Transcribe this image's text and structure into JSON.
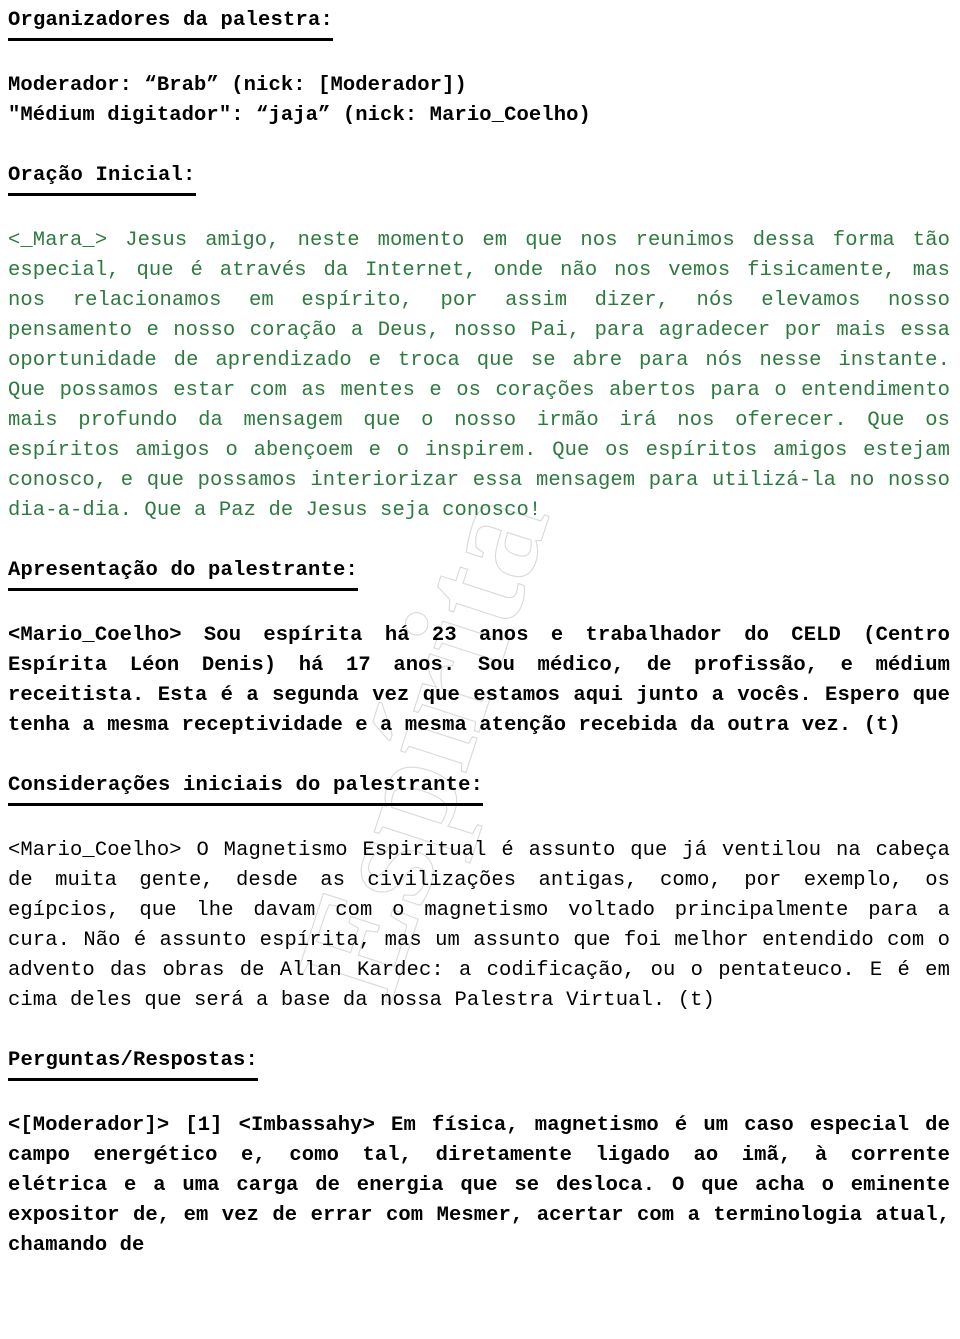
{
  "document": {
    "page_background": "#ffffff",
    "text_color": "#000000",
    "prayer_color": "#2d7a3e",
    "watermark_color": "#b9b9c4",
    "watermark_text": "Espírita"
  },
  "sections": {
    "organizers": {
      "heading": "Organizadores da palestra:",
      "lines": [
        "Moderador: “Brab” (nick: [Moderador])",
        "\"Médium digitador\": “jaja” (nick: Mario_Coelho)"
      ]
    },
    "opening_prayer": {
      "heading": "Oração Inicial:",
      "body": "<_Mara_> Jesus amigo, neste momento em que nos reunimos dessa forma tão especial, que é através da Internet, onde não nos vemos fisicamente, mas nos relacionamos em espírito, por assim dizer, nós elevamos nosso pensamento e nosso coração a Deus, nosso Pai, para agradecer por mais essa oportunidade de aprendizado e troca que se abre para nós nesse instante. Que possamos estar com as mentes e os corações abertos para o entendimento mais profundo da mensagem que o nosso irmão irá nos oferecer. Que os espíritos amigos o abençoem e o inspirem. Que os espíritos amigos estejam conosco, e que possamos interiorizar essa mensagem para utilizá-la no nosso dia-a-dia. Que a Paz de Jesus seja conosco!"
    },
    "speaker_intro": {
      "heading": "Apresentação do palestrante:",
      "body": "<Mario_Coelho> Sou espírita há 23 anos e trabalhador do CELD (Centro Espírita Léon Denis) há 17 anos. Sou médico, de profissão, e médium receitista. Esta é a segunda vez que estamos aqui junto a vocês. Espero que tenha a mesma receptividade e a mesma atenção recebida da outra vez. (t)"
    },
    "initial_considerations": {
      "heading": "Considerações iniciais do palestrante:",
      "body": "<Mario_Coelho> O Magnetismo Espiritual é assunto que já ventilou na cabeça de muita gente, desde as civilizações antigas, como, por exemplo, os egípcios, que lhe davam com o magnetismo voltado principalmente para a cura. Não é assunto espírita, mas um assunto que foi melhor entendido com o advento das obras de Allan Kardec: a codificação, ou o pentateuco. E é em cima deles que será a base da nossa Palestra Virtual. (t)"
    },
    "questions_answers": {
      "heading": "Perguntas/Respostas:",
      "body": "<[Moderador]> [1] <Imbassahy> Em física, magnetismo é um caso especial de campo energético e, como tal, diretamente ligado ao imã, à corrente elétrica e a uma carga de energia que se desloca. O que acha o eminente expositor de, em vez de errar com Mesmer, acertar com a terminologia atual, chamando de"
    }
  }
}
